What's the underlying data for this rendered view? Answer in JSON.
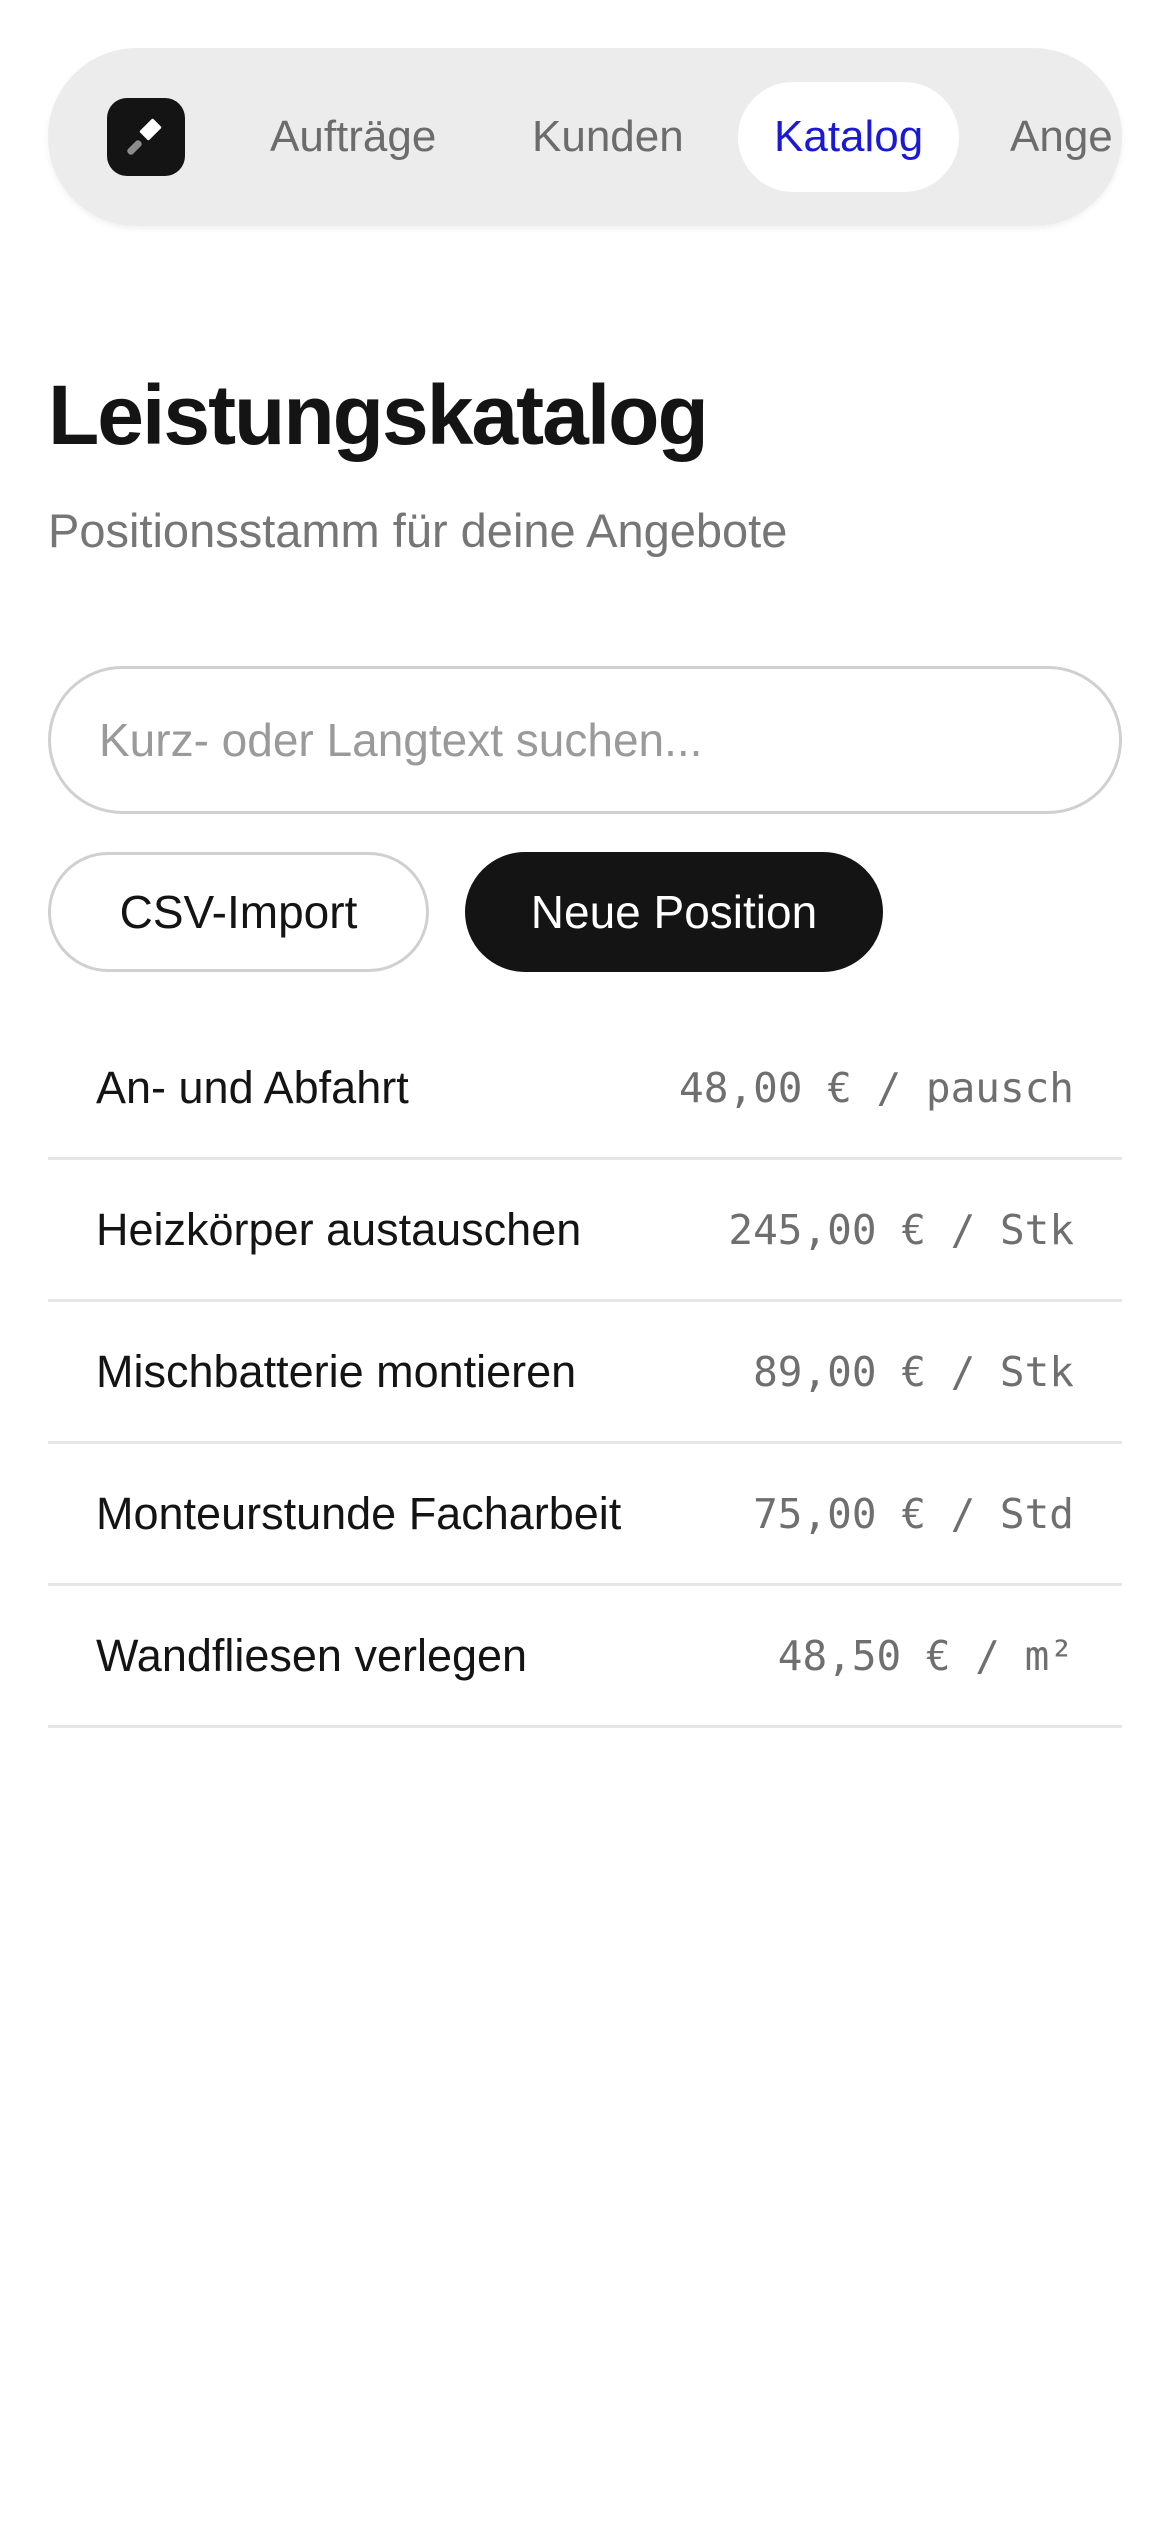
{
  "nav": {
    "logo_icon": "hammer-icon",
    "tabs": [
      {
        "label": "Aufträge",
        "active": false
      },
      {
        "label": "Kunden",
        "active": false
      },
      {
        "label": "Katalog",
        "active": true
      },
      {
        "label": "Ange",
        "active": false
      }
    ],
    "active_color": "#1a1ad6"
  },
  "header": {
    "title": "Leistungskatalog",
    "subtitle": "Positionsstamm für deine Angebote"
  },
  "search": {
    "placeholder": "Kurz- oder Langtext suchen...",
    "value": ""
  },
  "actions": {
    "csv_import_label": "CSV-Import",
    "new_position_label": "Neue Position"
  },
  "catalog": {
    "items": [
      {
        "name": "An- und Abfahrt",
        "price": "48,00 € / pausch"
      },
      {
        "name": "Heizkörper austauschen",
        "price": "245,00 € / Stk"
      },
      {
        "name": "Mischbatterie montieren",
        "price": "89,00 € / Stk"
      },
      {
        "name": "Monteurstunde Facharbeit",
        "price": "75,00 € / Std"
      },
      {
        "name": "Wandfliesen verlegen",
        "price": "48,50 € / m²"
      }
    ]
  }
}
